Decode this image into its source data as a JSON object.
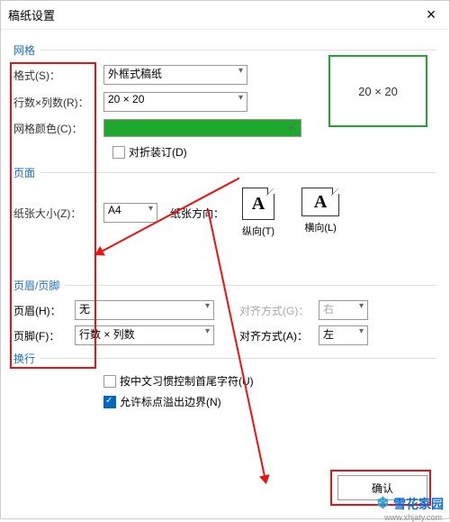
{
  "title": "稿纸设置",
  "sections": {
    "grid": "网格",
    "page": "页面",
    "headerFooter": "页眉/页脚",
    "wrap": "换行"
  },
  "labels": {
    "format": "格式(S)：",
    "rowsCols": "行数×列数(R)：",
    "gridColor": "网格颜色(C)：",
    "foldBinding": "对折装订(D)",
    "paperSize": "纸张大小(Z)：",
    "paperOrient": "纸张方向：",
    "portrait": "纵向(T)",
    "landscape": "横向(L)",
    "header": "页眉(H)：",
    "footer": "页脚(F)：",
    "alignG": "对齐方式(G)：",
    "alignA": "对齐方式(A)：",
    "cjkWrap": "按中文习惯控制首尾字符(U)",
    "punctOverflow": "允许标点溢出边界(N)",
    "confirm": "确认"
  },
  "values": {
    "format": "外框式稿纸",
    "rowsCols": "20 × 20",
    "preview": "20 × 20",
    "paperSize": "A4",
    "header": "无",
    "footer": "行数 × 列数",
    "alignG": "右",
    "alignA": "左",
    "gridColor": "#1ea82e",
    "foldBindingChecked": false,
    "cjkWrapChecked": false,
    "punctOverflowChecked": true
  },
  "watermark": {
    "text": "雪花家园",
    "url": "www.xhjaty.com"
  }
}
